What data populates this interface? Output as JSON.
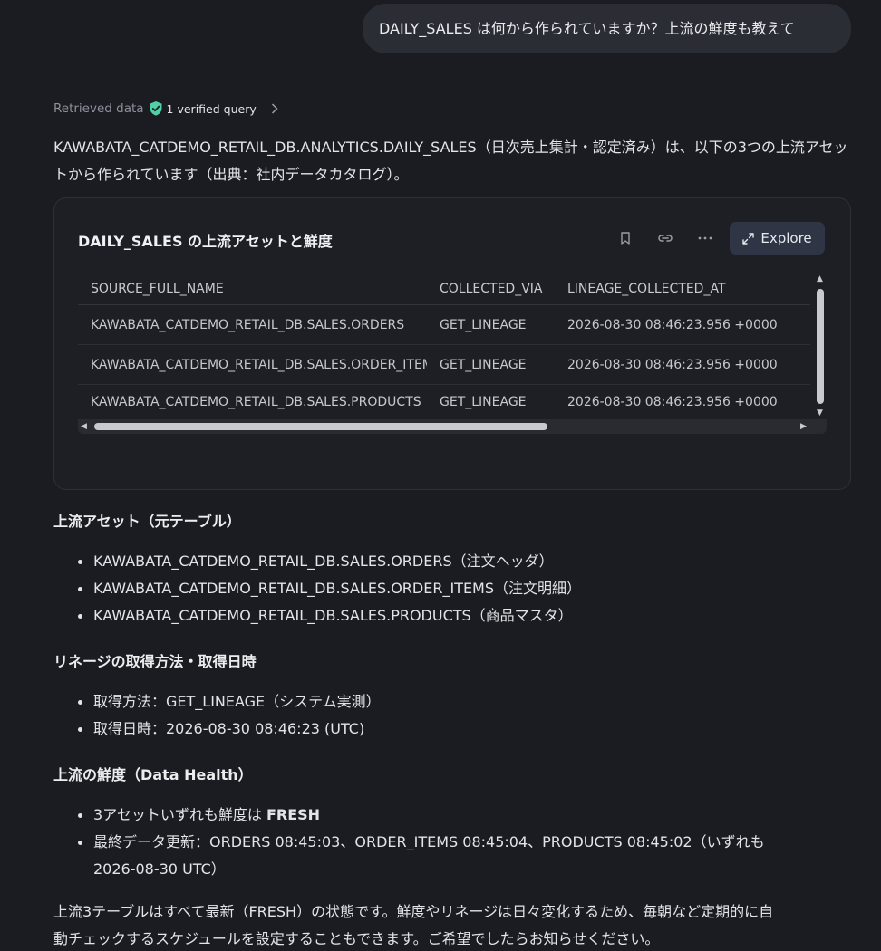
{
  "user_message": "DAILY_SALES は何から作られていますか？上流の鮮度も教えて",
  "retrieved": {
    "label": "Retrieved data",
    "verified": "1 verified query"
  },
  "intro": "KAWABATA_CATDEMO_RETAIL_DB.ANALYTICS.DAILY_SALES（日次売上集計・認定済み）は、以下の3つの上流アセットから作られています（出典：社内データカタログ）。",
  "card": {
    "title": "DAILY_SALES の上流アセットと鮮度",
    "explore_label": "Explore",
    "columns": [
      "SOURCE_FULL_NAME",
      "COLLECTED_VIA",
      "LINEAGE_COLLECTED_AT"
    ],
    "rows": [
      [
        "KAWABATA_CATDEMO_RETAIL_DB.SALES.ORDERS",
        "GET_LINEAGE",
        "2026-08-30 08:46:23.956 +0000"
      ],
      [
        "KAWABATA_CATDEMO_RETAIL_DB.SALES.ORDER_ITEMS",
        "GET_LINEAGE",
        "2026-08-30 08:46:23.956 +0000"
      ],
      [
        "KAWABATA_CATDEMO_RETAIL_DB.SALES.PRODUCTS",
        "GET_LINEAGE",
        "2026-08-30 08:46:23.956 +0000"
      ]
    ]
  },
  "sections": {
    "upstream": {
      "heading": "上流アセット（元テーブル）",
      "items": [
        "KAWABATA_CATDEMO_RETAIL_DB.SALES.ORDERS（注文ヘッダ）",
        "KAWABATA_CATDEMO_RETAIL_DB.SALES.ORDER_ITEMS（注文明細）",
        "KAWABATA_CATDEMO_RETAIL_DB.SALES.PRODUCTS（商品マスタ）"
      ]
    },
    "lineage": {
      "heading": "リネージの取得方法・取得日時",
      "items": [
        "取得方法：GET_LINEAGE（システム実測）",
        "取得日時：2026-08-30 08:46:23 (UTC)"
      ]
    },
    "freshness": {
      "heading": "上流の鮮度（Data Health）",
      "item1_prefix": "3アセットいずれも鮮度は ",
      "item1_bold": "FRESH",
      "item2_line1": "最終データ更新：ORDERS 08:45:03、ORDER_ITEMS 08:45:04、PRODUCTS 08:45:02（いずれも",
      "item2_line2": "2026-08-30 UTC）"
    }
  },
  "closing_line1": "上流3テーブルはすべて最新（FRESH）の状態です。鮮度やリネージは日々変化するため、毎朝など定期的に自",
  "closing_line2": "動チェックするスケジュールを設定することもできます。ご希望でしたらお知らせください。"
}
